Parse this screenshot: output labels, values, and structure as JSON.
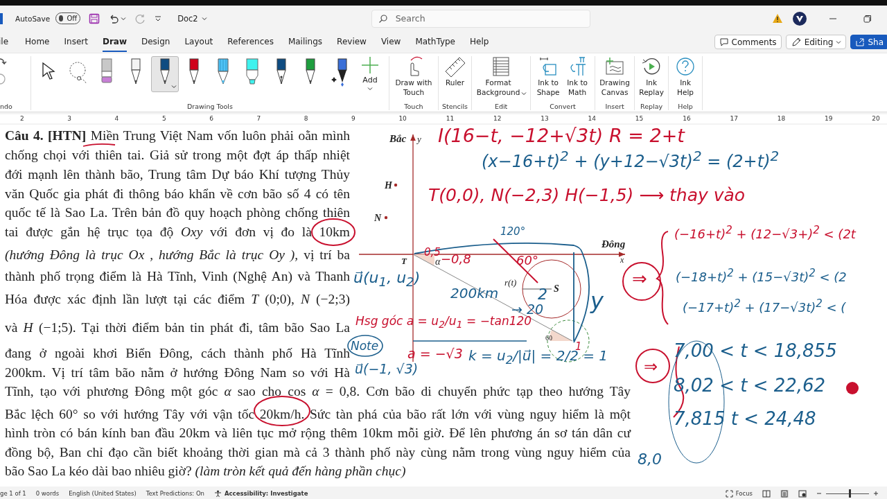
{
  "title_bar": {
    "autosave_label": "AutoSave",
    "autosave_toggle": {
      "on": false,
      "label": "Off"
    },
    "document_name": "Doc2",
    "search": {
      "placeholder": "Search"
    }
  },
  "tabs": [
    {
      "label": "ile",
      "selected": false
    },
    {
      "label": "Home",
      "selected": false
    },
    {
      "label": "Insert",
      "selected": false
    },
    {
      "label": "Draw",
      "selected": true
    },
    {
      "label": "Design",
      "selected": false
    },
    {
      "label": "Layout",
      "selected": false
    },
    {
      "label": "References",
      "selected": false
    },
    {
      "label": "Mailings",
      "selected": false
    },
    {
      "label": "Review",
      "selected": false
    },
    {
      "label": "View",
      "selected": false
    },
    {
      "label": "MathType",
      "selected": false
    },
    {
      "label": "Help",
      "selected": false
    }
  ],
  "header_buttons": [
    {
      "label": "Comments",
      "kind": "comments"
    },
    {
      "label": "Editing",
      "kind": "editing"
    },
    {
      "label": "Sha",
      "kind": "share"
    }
  ],
  "ribbon": {
    "groups": [
      {
        "label": "ndo",
        "kind": "undo"
      },
      {
        "label": "Drawing Tools",
        "kind": "tools",
        "add_label": "Add",
        "tools": [
          {
            "kind": "select",
            "selected": false
          },
          {
            "kind": "lasso",
            "selected": false
          },
          {
            "kind": "eraser",
            "selected": false
          },
          {
            "kind": "pen",
            "color": "#f4f4f4",
            "selected": false
          },
          {
            "kind": "pen",
            "color": "#0f4c81",
            "selected": true
          },
          {
            "kind": "pen",
            "color": "#d0021b",
            "selected": false
          },
          {
            "kind": "pencil",
            "color": "#4fc3f7",
            "selected": false
          },
          {
            "kind": "highlighter",
            "color": "#3ef2ee",
            "selected": false
          },
          {
            "kind": "fountain",
            "color": "#0f4c81",
            "selected": false
          },
          {
            "kind": "pen",
            "color": "#1e9e3e",
            "selected": false
          },
          {
            "kind": "galaxy",
            "color": "#3a6fd8",
            "selected": false
          }
        ]
      },
      {
        "label": "Touch",
        "kind": "buttons",
        "buttons": [
          {
            "label": "Draw with Touch",
            "kind": "touch"
          }
        ]
      },
      {
        "label": "Stencils",
        "kind": "buttons",
        "buttons": [
          {
            "label": "Ruler",
            "kind": "ruler"
          }
        ]
      },
      {
        "label": "Edit",
        "kind": "buttons",
        "buttons": [
          {
            "label": "Format Background",
            "kind": "background"
          }
        ]
      },
      {
        "label": "Convert",
        "kind": "buttons",
        "buttons": [
          {
            "label": "Ink to Shape",
            "kind": "shape"
          },
          {
            "label": "Ink to Math",
            "kind": "math"
          }
        ]
      },
      {
        "label": "Insert",
        "kind": "buttons",
        "buttons": [
          {
            "label": "Drawing Canvas",
            "kind": "canvas"
          }
        ]
      },
      {
        "label": "Replay",
        "kind": "buttons",
        "buttons": [
          {
            "label": "Ink Replay",
            "kind": "replay"
          }
        ]
      },
      {
        "label": "Help",
        "kind": "buttons",
        "buttons": [
          {
            "label": "Ink Help",
            "kind": "help"
          }
        ]
      }
    ]
  },
  "ruler": {
    "numbers": [
      "2",
      "3",
      "4",
      "5",
      "6",
      "7",
      "8",
      "9",
      "10",
      "11",
      "12",
      "13",
      "14",
      "15",
      "16",
      "17",
      "18",
      "19",
      "20"
    ]
  },
  "document": {
    "lines": [
      "**Câu 4. [HTN]** Miền Trung Việt Nam vốn luôn phải oằn mình",
      "chống chọi với thiên tai. Giả sử trong một đợt áp thấp nhiệt",
      "đới mạnh lên thành bão, Trung tâm Dự báo Khí tượng Thủy",
      "văn Quốc gia phát đi thông báo khẩn về cơn bão số 4 có tên",
      "quốc tế là Sao La. Trên bản đồ quy hoạch phòng chống thiên",
      "tai được gắn hệ trục tọa độ *Oxy* với đơn vị đo là 10km",
      "*(hướng Đông là trục Ox , hướng Bắc là trục Oy ),* vị trí ba",
      "thành phố trọng điểm là Hà Tĩnh, Vinh (Nghệ An) và Thanh",
      "Hóa được xác định lần lượt tại các điểm *T* (0;0), *N* (−2;3)",
      "và *H* (−1;5). Tại thời điểm bản tin phát đi, tâm bão Sao La",
      "đang ở ngoài khơi Biển Đông, cách thành phố Hà Tĩnh",
      "200km. Vị trí tâm bão nằm ở hướng Đông Nam so với Hà",
      "Tĩnh, tạo với phương Đông một góc *α* sao cho cos *α* = 0,8. Cơn bão di chuyển phức tạp theo hướng Tây",
      "Bắc lệch 60° so với hướng Tây với vận tốc 20km/h. Sức tàn phá của bão rất lớn với vùng nguy hiểm là một",
      "hình tròn có bán kính ban đầu 20km và liên tục mở rộng thêm 10km mỗi giờ. Để lên phương án sơ tán dân cư",
      "đồng bộ, Ban chỉ đạo cần biết khoảng thời gian mà cả 3 thành phố này cùng nằm trong vùng nguy hiểm của",
      "bão Sao La kéo dài bao nhiêu giờ? *(làm tròn kết quả đến hàng phần chục)*"
    ],
    "diagram_labels": [
      "Bắc",
      "y",
      "H",
      "N",
      "T",
      "Đông",
      "x",
      "r(t)",
      "S",
      "60",
      "α"
    ],
    "ink_notes": [
      {
        "text": "I(16−t, −12+√3t)  R = 2+t",
        "color": "#c8102e"
      },
      {
        "text": "(x−16+t)$^{2}$ + (y+12−√3t)$^{2}$ = (2+t)$^{2}$",
        "color": "#1b5e8c"
      },
      {
        "text": "T(0,0), N(−2,3) H(−1,5) ⟶ thay vào",
        "color": "#c8102e"
      },
      {
        "text": "120°",
        "color": "#1b5e8c"
      },
      {
        "text": "(−16+t)$^{2}$ + (12−√3+)$^{2}$ < (2t",
        "color": "#c8102e"
      },
      {
        "text": "0,5",
        "color": "#c8102e"
      },
      {
        "text": "−0,8",
        "color": "#c8102e"
      },
      {
        "text": "60°",
        "color": "#c8102e"
      },
      {
        "text": "u⃗(u$_{1}$, u$_{2}$)",
        "color": "#1b5e8c"
      },
      {
        "text": "⇒",
        "color": "#c8102e"
      },
      {
        "text": "(−18+t)$^{2}$ + (15−√3t)$^{2}$ < (2",
        "color": "#1b5e8c"
      },
      {
        "text": "200km",
        "color": "#1b5e8c"
      },
      {
        "text": "2",
        "color": "#1b5e8c"
      },
      {
        "text": "→ 20",
        "color": "#1b5e8c"
      },
      {
        "text": "y",
        "color": "#1b5e8c"
      },
      {
        "text": "(−17+t)$^{2}$ + (17−√3t)$^{2}$ < (",
        "color": "#1b5e8c"
      },
      {
        "text": "Hsg góc a = u$_{2}$/u$_{1}$ = −tan120",
        "color": "#c8102e"
      },
      {
        "text": "Note",
        "color": "#1b5e8c"
      },
      {
        "text": "a = −√3",
        "color": "#c8102e"
      },
      {
        "text": "k = u$_{2}$/|u⃗| = 2/2 = 1",
        "color": "#1b5e8c"
      },
      {
        "text": "1",
        "color": "#c8102e"
      },
      {
        "text": "7,00 < t < 18,855",
        "color": "#1b5e8c"
      },
      {
        "text": "u⃗(−1, √3)",
        "color": "#1b5e8c"
      },
      {
        "text": "⇒",
        "color": "#c8102e"
      },
      {
        "text": "8,02 < t < 22,62",
        "color": "#1b5e8c"
      },
      {
        "text": "7,815  t < 24,48",
        "color": "#1b5e8c"
      },
      {
        "text": "8,0",
        "color": "#1b5e8c"
      }
    ]
  },
  "status_bar": {
    "items": [
      "ge 1 of 1",
      "0 words",
      "English (United States)",
      "Text Predictions: On"
    ],
    "accessibility": "Accessibility: Investigate",
    "focus": "Focus",
    "zoom": {
      "level": 0.55
    }
  }
}
